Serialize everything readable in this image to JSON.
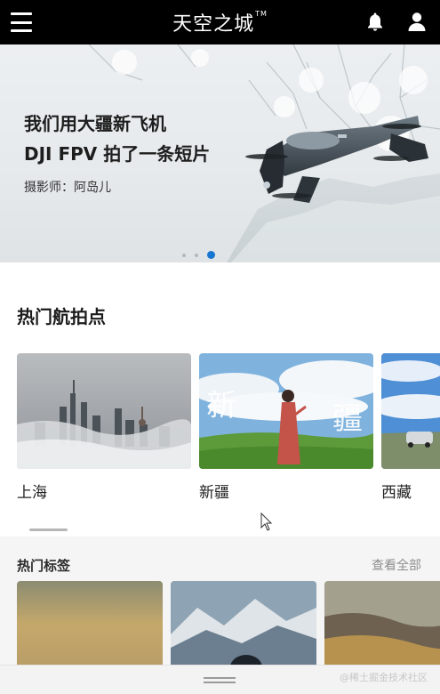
{
  "header": {
    "brand": "天空之城",
    "brand_mark": "TM",
    "menu_icon": "hamburger-menu-icon",
    "bell_icon": "bell-icon",
    "user_icon": "user-icon"
  },
  "banner": {
    "title_line1": "我们用大疆新飞机",
    "title_line2": "DJI FPV 拍了一条短片",
    "credit": "摄影师：阿岛儿",
    "slides_total": 3,
    "active_slide": 3
  },
  "hot_spots": {
    "title": "热门航拍点",
    "items": [
      {
        "label": "上海"
      },
      {
        "label": "新疆"
      },
      {
        "label": "西藏"
      }
    ]
  },
  "hot_tags": {
    "title": "热门标签",
    "view_all": "查看全部"
  },
  "footer": {
    "watermark": "@稀土掘金技术社区"
  },
  "colors": {
    "topbar": "#000000",
    "accent": "#1776d2",
    "tags_bg": "#f5f5f5"
  }
}
